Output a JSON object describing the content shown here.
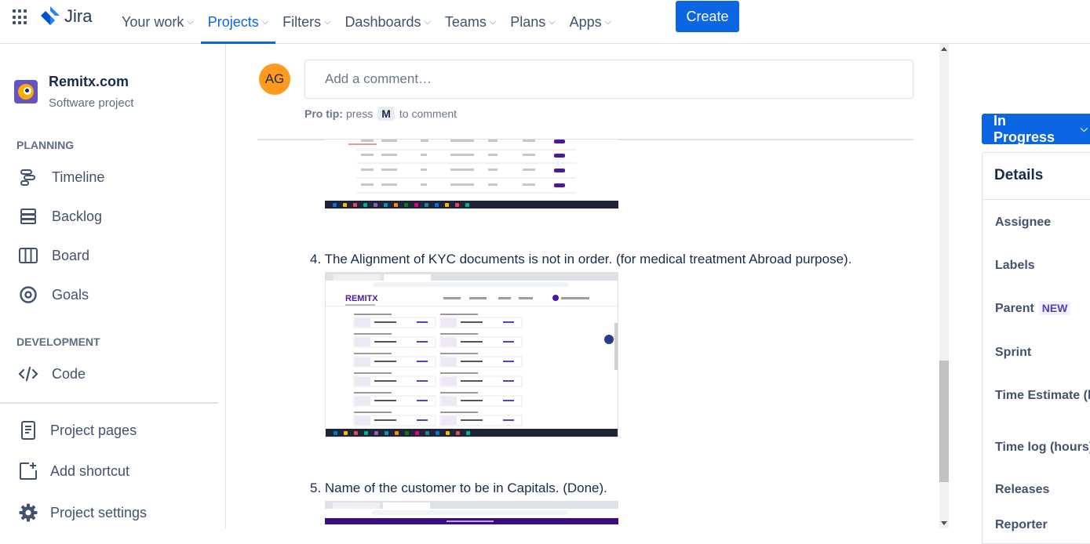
{
  "topbar": {
    "logo_text": "Jira",
    "nav": [
      {
        "label": "Your work",
        "active": false
      },
      {
        "label": "Projects",
        "active": true
      },
      {
        "label": "Filters",
        "active": false
      },
      {
        "label": "Dashboards",
        "active": false
      },
      {
        "label": "Teams",
        "active": false
      },
      {
        "label": "Plans",
        "active": false
      },
      {
        "label": "Apps",
        "active": false
      }
    ],
    "create_label": "Create"
  },
  "sidebar": {
    "project_name": "Remitx.com",
    "project_type": "Software project",
    "planning_heading": "PLANNING",
    "planning_items": [
      {
        "label": "Timeline",
        "icon": "timeline-icon"
      },
      {
        "label": "Backlog",
        "icon": "backlog-icon"
      },
      {
        "label": "Board",
        "icon": "board-icon"
      },
      {
        "label": "Goals",
        "icon": "goals-icon"
      }
    ],
    "development_heading": "DEVELOPMENT",
    "development_items": [
      {
        "label": "Code",
        "icon": "code-icon"
      }
    ],
    "footer_items": [
      {
        "label": "Project pages",
        "icon": "page-icon"
      },
      {
        "label": "Add shortcut",
        "icon": "add-shortcut-icon"
      },
      {
        "label": "Project settings",
        "icon": "gear-icon"
      }
    ]
  },
  "comment": {
    "avatar_initials": "AG",
    "placeholder": "Add a comment…",
    "protip_bold": "Pro tip:",
    "protip_press": "press",
    "protip_key": "M",
    "protip_rest": "to comment"
  },
  "description": {
    "item4": "4.  The Alignment of KYC documents is not in order. (for medical treatment Abroad purpose).",
    "item5": "5. Name of the customer to be in Capitals. (Done).",
    "screenshot_brand": "REMITX"
  },
  "right_panel": {
    "status_label": "In Progress",
    "details_heading": "Details",
    "fields": [
      {
        "label": "Assignee",
        "badge": ""
      },
      {
        "label": "Labels",
        "badge": ""
      },
      {
        "label": "Parent",
        "badge": "NEW"
      },
      {
        "label": "Sprint",
        "badge": ""
      },
      {
        "label": "Time Estimate (hours)",
        "badge": ""
      },
      {
        "label": "Time log (hours)",
        "badge": ""
      },
      {
        "label": "Releases",
        "badge": ""
      },
      {
        "label": "Reporter",
        "badge": ""
      }
    ]
  },
  "colors": {
    "brand_blue": "#0c66e4",
    "avatar": "#ff991f",
    "remitx_purple": "#4a1a9c"
  }
}
